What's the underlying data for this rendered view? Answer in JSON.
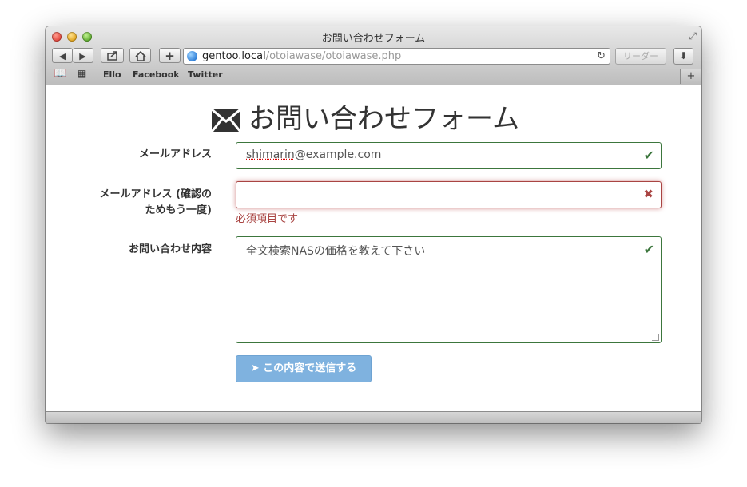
{
  "window": {
    "title": "お問い合わせフォーム"
  },
  "toolbar": {
    "back_icon": "◀",
    "forward_icon": "▶",
    "reader_label": "リーダー"
  },
  "url": {
    "host": "gentoo.local",
    "path": "/otoiawase/otoiawase.php"
  },
  "bookmarks": [
    {
      "label": "Ello"
    },
    {
      "label": "Facebook"
    },
    {
      "label": "Twitter"
    }
  ],
  "form": {
    "heading": "お問い合わせフォーム",
    "email_label": "メールアドレス",
    "email_value_misspelled": "shimarin",
    "email_value_rest": "@example.com",
    "confirm_label_line1": "メールアドレス (確認の",
    "confirm_label_line2": "ためもう一度)",
    "confirm_value": "",
    "confirm_error": "必須項目です",
    "message_label": "お問い合わせ内容",
    "message_value": "全文検索NASの価格を教えて下さい",
    "submit_label": "この内容で送信する"
  },
  "colors": {
    "success": "#3c763d",
    "error": "#a94442",
    "button": "#7fb2df"
  },
  "icons": {
    "valid": "check-icon",
    "invalid": "x-icon",
    "heading": "envelope-icon",
    "submit": "paper-plane-icon"
  }
}
